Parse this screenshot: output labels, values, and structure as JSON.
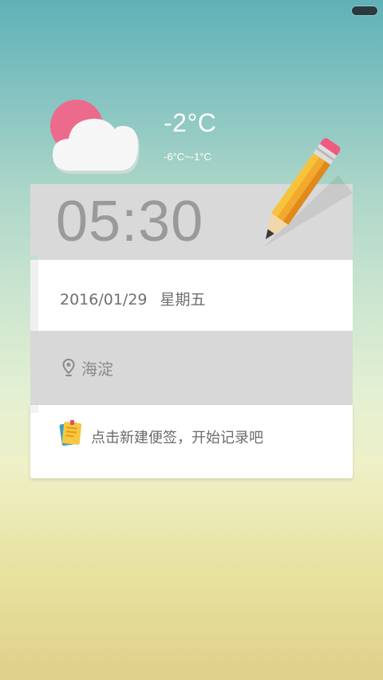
{
  "status_bar": {
    "battery_icon": "battery-icon"
  },
  "weather": {
    "icon": "partly-cloudy-icon",
    "temperature": "-2°C",
    "range": "-6°C~-1°C"
  },
  "clock": {
    "time": "05:30"
  },
  "date": {
    "day": "2016/01/29",
    "weekday": "星期五"
  },
  "location": {
    "icon": "location-pin-icon",
    "name": "海淀"
  },
  "note": {
    "icon": "note-icon",
    "hint": "点击新建便签，开始记录吧"
  },
  "decoration": {
    "icon": "pencil-icon"
  },
  "colors": {
    "sun": "#ec6a8c",
    "cloud": "#f7f7f7",
    "panel_gray": "#d8d8d8",
    "panel_white": "#ffffff",
    "pencil_yellow": "#f4b43c"
  }
}
